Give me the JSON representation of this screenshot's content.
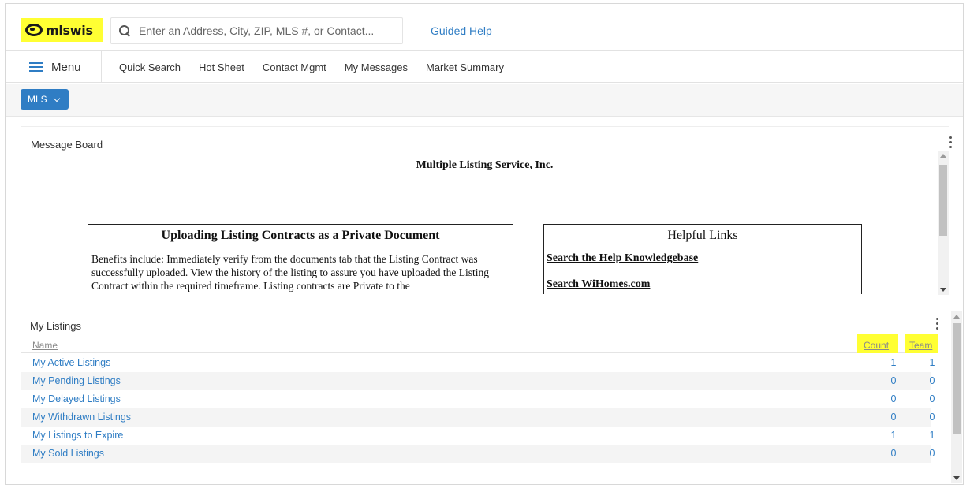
{
  "header": {
    "logo_text": "mlswis",
    "search_placeholder": "Enter an Address, City, ZIP, MLS #, or Contact...",
    "guided_help": "Guided Help"
  },
  "nav": {
    "menu_label": "Menu",
    "items": [
      "Quick Search",
      "Hot Sheet",
      "Contact Mgmt",
      "My Messages",
      "Market Summary"
    ]
  },
  "mls_button": {
    "label": "MLS"
  },
  "message_board": {
    "title": "Message Board",
    "heading": "Multiple Listing Service, Inc.",
    "left_box": {
      "title": "Uploading Listing Contracts as a Private Document",
      "body": "Benefits include: Immediately verify from the documents tab that the Listing Contract was successfully uploaded. View the history of the listing to assure you have uploaded the Listing Contract within the required timeframe. Listing contracts are Private to the"
    },
    "right_box": {
      "title": "Helpful Links",
      "links": [
        "Search the Help Knowledgebase",
        "Search WiHomes.com"
      ]
    }
  },
  "my_listings": {
    "title": "My Listings",
    "columns": {
      "name": "Name",
      "count": "Count",
      "team": "Team"
    },
    "rows": [
      {
        "name": "My Active Listings",
        "count": "1",
        "team": "1"
      },
      {
        "name": "My Pending Listings",
        "count": "0",
        "team": "0"
      },
      {
        "name": "My Delayed Listings",
        "count": "0",
        "team": "0"
      },
      {
        "name": "My Withdrawn Listings",
        "count": "0",
        "team": "0"
      },
      {
        "name": "My Listings to Expire",
        "count": "1",
        "team": "1"
      },
      {
        "name": "My Sold Listings",
        "count": "0",
        "team": "0"
      }
    ]
  },
  "colors": {
    "accent": "#2f7dc4",
    "highlight": "#ffff33",
    "mls_button": "#2f7dc4"
  }
}
